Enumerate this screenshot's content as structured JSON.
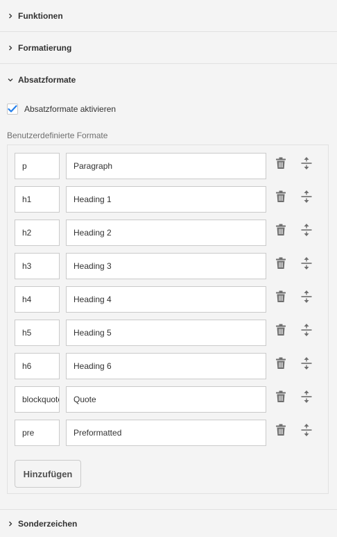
{
  "sections": {
    "funktionen": "Funktionen",
    "formatierung": "Formatierung",
    "absatzformate": "Absatzformate",
    "sonderzeichen": "Sonderzeichen"
  },
  "enable_paragraph_formats": {
    "label": "Absatzformate aktivieren",
    "checked": true
  },
  "custom_formats": {
    "label": "Benutzerdefinierte Formate",
    "rows": [
      {
        "tag": "p",
        "name": "Paragraph"
      },
      {
        "tag": "h1",
        "name": "Heading 1"
      },
      {
        "tag": "h2",
        "name": "Heading 2"
      },
      {
        "tag": "h3",
        "name": "Heading 3"
      },
      {
        "tag": "h4",
        "name": "Heading 4"
      },
      {
        "tag": "h5",
        "name": "Heading 5"
      },
      {
        "tag": "h6",
        "name": "Heading 6"
      },
      {
        "tag": "blockquote",
        "name": "Quote"
      },
      {
        "tag": "pre",
        "name": "Preformatted"
      }
    ],
    "add_label": "Hinzufügen"
  },
  "icons": {
    "delete": "trash-icon",
    "reorder": "drag-handle-icon",
    "collapsed": "chevron-right-icon",
    "expanded": "chevron-down-icon"
  },
  "colors": {
    "accent": "#2680eb",
    "background": "#f4f4f4",
    "icon": "#6e6e6e"
  }
}
